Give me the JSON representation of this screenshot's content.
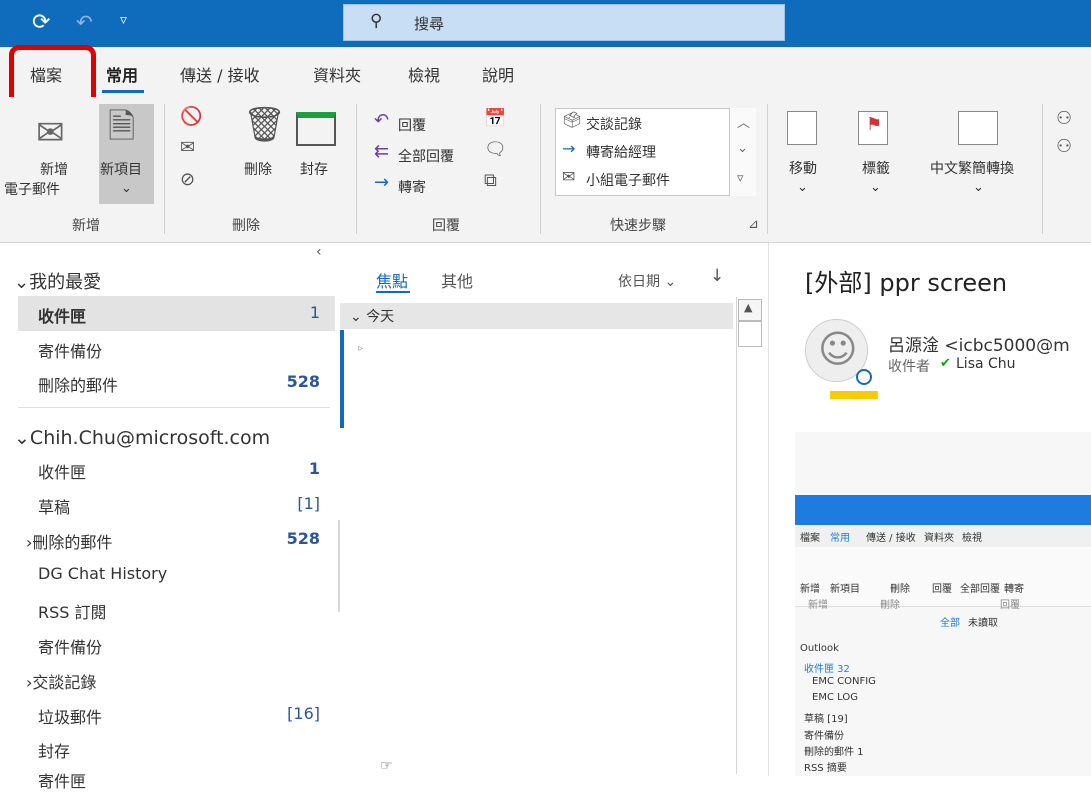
{
  "search": {
    "placeholder": "搜尋"
  },
  "ribbon_tabs": [
    {
      "label": "檔案"
    },
    {
      "label": "常用"
    },
    {
      "label": "傳送 / 接收"
    },
    {
      "label": "資料夾"
    },
    {
      "label": "檢視"
    },
    {
      "label": "說明"
    }
  ],
  "ribbon": {
    "new_email": [
      "新增",
      "電子郵件"
    ],
    "new_item": "新項目",
    "delete": "刪除",
    "archive": "封存",
    "reply": "回覆",
    "reply_all": "全部回覆",
    "forward": "轉寄",
    "quick_steps": [
      "交談記錄",
      "轉寄給經理",
      "小組電子郵件"
    ],
    "move": "移動",
    "tags": "標籤",
    "chinese_conversion": "中文繁簡轉換",
    "groups": {
      "new": "新增",
      "delete": "刪除",
      "reply": "回覆",
      "quick_steps": "快速步驟"
    }
  },
  "favorites": {
    "header": "我的最愛",
    "items": [
      {
        "label": "收件匣",
        "count": "1"
      },
      {
        "label": "寄件備份",
        "count": ""
      },
      {
        "label": "刪除的郵件",
        "count": "528"
      }
    ]
  },
  "account": {
    "header": "Chih.Chu@microsoft.com",
    "items": [
      {
        "label": "收件匣",
        "count": "1"
      },
      {
        "label": "草稿",
        "count": "[1]"
      },
      {
        "label": "刪除的郵件",
        "count": "528"
      },
      {
        "label": "DG Chat History",
        "count": ""
      },
      {
        "label": "RSS 訂閱",
        "count": ""
      },
      {
        "label": "寄件備份",
        "count": ""
      },
      {
        "label": "交談記錄",
        "count": ""
      },
      {
        "label": "垃圾郵件",
        "count": "[16]"
      },
      {
        "label": "封存",
        "count": ""
      },
      {
        "label": "寄件匣",
        "count": ""
      }
    ]
  },
  "message_list": {
    "tab_focused": "焦點",
    "tab_other": "其他",
    "sort": "依日期",
    "group_today": "今天"
  },
  "reading": {
    "subject": "[外部] ppr screen",
    "sender": "呂源淦 <icbc5000@m",
    "to_label": "收件者",
    "recipient": "Lisa Chu"
  },
  "embedded_screenshot": {
    "tabs": [
      "檔案",
      "常用",
      "傳送 / 接收",
      "資料夾",
      "檢視"
    ],
    "ribbon_labels": [
      "新增",
      "新項目",
      "刪除",
      "回覆",
      "全部回覆",
      "轉寄"
    ],
    "ribbon_groups": [
      "新增",
      "刪除",
      "回覆"
    ],
    "list_tabs": [
      "全部",
      "未讀取"
    ],
    "folders": [
      "Outlook",
      "收件匣 32",
      "EMC CONFIG",
      "EMC LOG",
      "草稿 [19]",
      "寄件備份",
      "刪除的郵件 1",
      "RSS 摘要"
    ]
  },
  "colors": {
    "accent": "#0f6cbd",
    "highlight": "#e00000",
    "count": "#2b579a"
  }
}
